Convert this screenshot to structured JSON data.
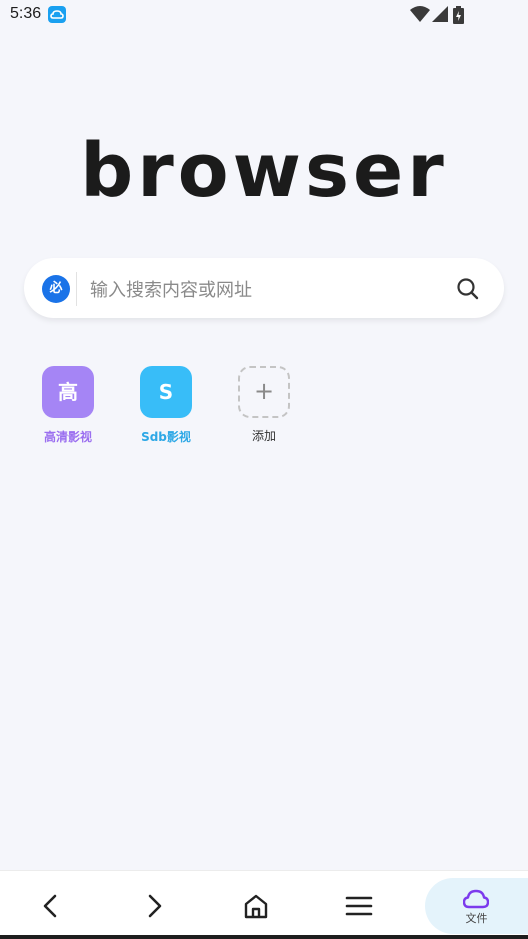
{
  "status_bar": {
    "time": "5:36",
    "icons": [
      "cloud-notification-icon",
      "wifi-icon",
      "signal-icon",
      "battery-icon"
    ]
  },
  "logo": "browser",
  "search": {
    "engine_label": "必",
    "placeholder": "输入搜索内容或网址",
    "engine_color": "#1a73e8"
  },
  "shortcuts": [
    {
      "icon_text": "高",
      "label": "高清影视",
      "color": "#a585f5",
      "label_color": "#9b6ff0"
    },
    {
      "icon_text": "S",
      "label": "Sdb影视",
      "color": "#38bdf8",
      "label_color": "#2ea8e6"
    },
    {
      "icon_text": "+",
      "label": "添加",
      "color": "",
      "label_color": "#333333"
    }
  ],
  "bottom_nav": {
    "files_label": "文件",
    "accent": "#7c3aed"
  }
}
